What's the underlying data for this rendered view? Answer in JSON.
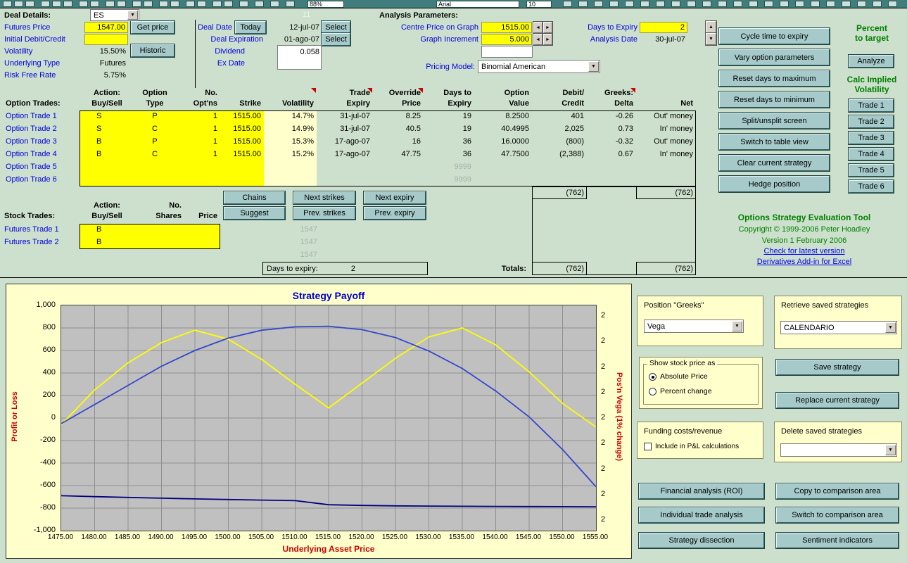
{
  "toolbar": {
    "font_name": "Arial",
    "font_size": "10",
    "zoom": "88%",
    "row_indicator": "11"
  },
  "icons": {
    "chevron_down": "▼",
    "arrow_left": "◄",
    "arrow_right": "►",
    "arrow_up": "▲",
    "arrow_down": "▼"
  },
  "colors": {
    "page_bg": "#cde0cd",
    "input_yellow": "#ffff00",
    "button_teal": "#a6caca",
    "chart_bg": "#ffffcc",
    "plot_bg": "#c0c0c0",
    "label_blue": "#0000dd",
    "brand_green": "#008000",
    "accent_red": "#cc0000"
  },
  "deal": {
    "section_title": "Deal Details:",
    "symbol": "ES",
    "get_price": "Get price",
    "historic": "Historic",
    "fields": [
      {
        "label": "Futures Price",
        "value": "1547.00"
      },
      {
        "label": "Initial Debit/Credit",
        "value": ""
      },
      {
        "label": "Volatility",
        "value": "15.50%"
      },
      {
        "label": "Underlying Type",
        "value": "Futures"
      },
      {
        "label": "Risk Free Rate",
        "value": "5.75%"
      }
    ]
  },
  "analysis": {
    "section_title": "Analysis Parameters:",
    "deal_date_label": "Deal Date",
    "today_button": "Today",
    "deal_date": "12-jul-07",
    "select_button": "Select",
    "deal_expiration_label": "Deal Expiration",
    "deal_expiration": "01-ago-07",
    "dividend_label": "Dividend",
    "dividend": "0.058",
    "ex_date_label": "Ex Date",
    "pricing_model_label": "Pricing Model:",
    "pricing_model": "Binomial American",
    "centre_price_label": "Centre Price on Graph",
    "centre_price": "1515.00",
    "graph_increment_label": "Graph Increment",
    "graph_increment": "5.000",
    "days_to_expiry_label": "Days to Expiry",
    "days_to_expiry": "2",
    "analysis_date_label": "Analysis Date",
    "analysis_date": "30-jul-07"
  },
  "action_buttons": [
    "Cycle time to expiry",
    "Vary option parameters",
    "Reset days to maximum",
    "Reset days to minimum",
    "Split/unsplit screen",
    "Switch to table view",
    "Clear current strategy",
    "Hedge position"
  ],
  "target_panel": {
    "title_line1": "Percent",
    "title_line2": "to target",
    "analyze": "Analyze",
    "calc_line1": "Calc Implied",
    "calc_line2": "Volatility",
    "trade_buttons": [
      "Trade 1",
      "Trade 2",
      "Trade 3",
      "Trade 4",
      "Trade 5",
      "Trade 6"
    ]
  },
  "option_trades": {
    "row_label_header": "Option Trades:",
    "headers_line1": [
      "Action:",
      "Option",
      "No.",
      "",
      "",
      "Trade",
      "Override",
      "Days to",
      "Option",
      "Debit/",
      "Greeks:",
      ""
    ],
    "headers_line2": [
      "Buy/Sell",
      "Type",
      "Opt'ns",
      "Strike",
      "Volatility",
      "Expiry",
      "Price",
      "Expiry",
      "Value",
      "Credit",
      "Delta",
      "Net"
    ],
    "rows": [
      {
        "label": "Option Trade 1",
        "action": "S",
        "type": "P",
        "num": "1",
        "strike": "1515.00",
        "vol": "14.7%",
        "expiry": "31-jul-07",
        "override": "8.25",
        "days": "19",
        "value": "8.2500",
        "debit": "401",
        "delta": "-0.26",
        "net": "Out' money"
      },
      {
        "label": "Option Trade 2",
        "action": "S",
        "type": "C",
        "num": "1",
        "strike": "1515.00",
        "vol": "14.9%",
        "expiry": "31-jul-07",
        "override": "40.5",
        "days": "19",
        "value": "40.4995",
        "debit": "2,025",
        "delta": "0.73",
        "net": "In' money"
      },
      {
        "label": "Option Trade 3",
        "action": "B",
        "type": "P",
        "num": "1",
        "strike": "1515.00",
        "vol": "15.3%",
        "expiry": "17-ago-07",
        "override": "16",
        "days": "36",
        "value": "16.0000",
        "debit": "(800)",
        "delta": "-0.32",
        "net": "Out' money"
      },
      {
        "label": "Option Trade 4",
        "action": "B",
        "type": "C",
        "num": "1",
        "strike": "1515.00",
        "vol": "15.2%",
        "expiry": "17-ago-07",
        "override": "47.75",
        "days": "36",
        "value": "47.7500",
        "debit": "(2,388)",
        "delta": "0.67",
        "net": "In' money"
      },
      {
        "label": "Option Trade 5",
        "action": "",
        "type": "",
        "num": "",
        "strike": "",
        "vol": "",
        "expiry": "",
        "override": "",
        "days": "9999",
        "days_muted": true,
        "value": "",
        "debit": "",
        "delta": "",
        "net": ""
      },
      {
        "label": "Option Trade 6",
        "action": "",
        "type": "",
        "num": "",
        "strike": "",
        "vol": "",
        "expiry": "",
        "override": "",
        "days": "9999",
        "days_muted": true,
        "value": "",
        "debit": "",
        "delta": "",
        "net": ""
      }
    ],
    "subtotal_debit": "(762)",
    "subtotal_net": "(762)"
  },
  "mid_buttons": {
    "chains": "Chains",
    "suggest": "Suggest",
    "next_strikes": "Next strikes",
    "prev_strikes": "Prev. strikes",
    "next_expiry": "Next expiry",
    "prev_expiry": "Prev. expiry"
  },
  "stock_trades": {
    "row_label_header": "Stock Trades:",
    "headers_line1": [
      "Action:",
      "No.",
      ""
    ],
    "headers_line2": [
      "Buy/Sell",
      "Shares",
      "Price"
    ],
    "rows": [
      {
        "label": "Futures Trade 1",
        "action": "B",
        "ghost_price": "1547"
      },
      {
        "label": "Futures Trade 2",
        "action": "B",
        "ghost_price": "1547"
      }
    ],
    "ghost_extra": "1547",
    "days_box_label": "Days to expiry:",
    "days_box_value": "2",
    "totals_label": "Totals:",
    "totals_debit": "(762)",
    "totals_net": "(762)"
  },
  "branding": {
    "title": "Options Strategy Evaluation Tool",
    "copyright": "Copyright © 1999-2006 Peter Hoadley",
    "version": "Version 1 February 2006",
    "link1": "Check for latest version",
    "link2": "Derivatives Add-in for Excel"
  },
  "chart_data": {
    "type": "line",
    "title": "Strategy Payoff",
    "xlabel": "Underlying Asset Price",
    "ylabel_left": "Profit or Loss",
    "ylabel_right": "Pos'n Vega (1% change)",
    "xlim": [
      1475,
      1555
    ],
    "ylim_left": [
      -1000,
      1000
    ],
    "grid": true,
    "legend": false,
    "x": [
      1475,
      1480,
      1485,
      1490,
      1495,
      1500,
      1505,
      1510,
      1515,
      1520,
      1525,
      1530,
      1535,
      1540,
      1545,
      1550,
      1555
    ],
    "x_tick_labels": [
      "1475.00",
      "1480.00",
      "1485.00",
      "1490.00",
      "1495.00",
      "1500.00",
      "1505.00",
      "1510.00",
      "1515.00",
      "1520.00",
      "1525.00",
      "1530.00",
      "1535.00",
      "1540.00",
      "1545.00",
      "1550.00",
      "1555.00"
    ],
    "y_ticks_left": [
      "1,000",
      "800",
      "600",
      "400",
      "200",
      "0",
      "-200",
      "-400",
      "-600",
      "-800",
      "-1,000"
    ],
    "right_axis_tick_label": "2",
    "right_axis_tick_count": 9,
    "series": [
      {
        "name": "payoff at expiry",
        "color": "#ffff00",
        "axis": "left",
        "values": [
          -60,
          250,
          490,
          670,
          780,
          700,
          520,
          300,
          90,
          310,
          530,
          720,
          800,
          650,
          410,
          130,
          -80
        ]
      },
      {
        "name": "current value",
        "color": "#3347cc",
        "axis": "left",
        "values": [
          -50,
          120,
          290,
          460,
          600,
          710,
          780,
          810,
          815,
          785,
          715,
          595,
          440,
          240,
          10,
          -280,
          -610
        ]
      },
      {
        "name": "position vega (plotted vs right axis)",
        "color": "#000080",
        "axis": "right",
        "values": [
          -690,
          -698,
          -705,
          -712,
          -718,
          -724,
          -729,
          -734,
          -770,
          -776,
          -780,
          -782,
          -784,
          -785,
          -786,
          -787,
          -788
        ]
      }
    ]
  },
  "right_panel": {
    "greeks_title": "Position \"Greeks\"",
    "greeks_value": "Vega",
    "retrieve_title": "Retrieve saved strategies",
    "retrieve_value": "CALENDARIO",
    "save_button": "Save strategy",
    "show_price_title": "Show stock price as",
    "radio_absolute": "Absolute Price",
    "radio_percent": "Percent change",
    "replace_button": "Replace current strategy",
    "funding_title": "Funding costs/revenue",
    "funding_checkbox": "Include in P&L calculations",
    "delete_title": "Delete saved strategies",
    "delete_value": "",
    "buttons": [
      "Financial analysis (ROI)",
      "Copy to comparison area",
      "Individual trade analysis",
      "Switch to comparison area",
      "Strategy dissection",
      "Sentiment indicators"
    ]
  }
}
